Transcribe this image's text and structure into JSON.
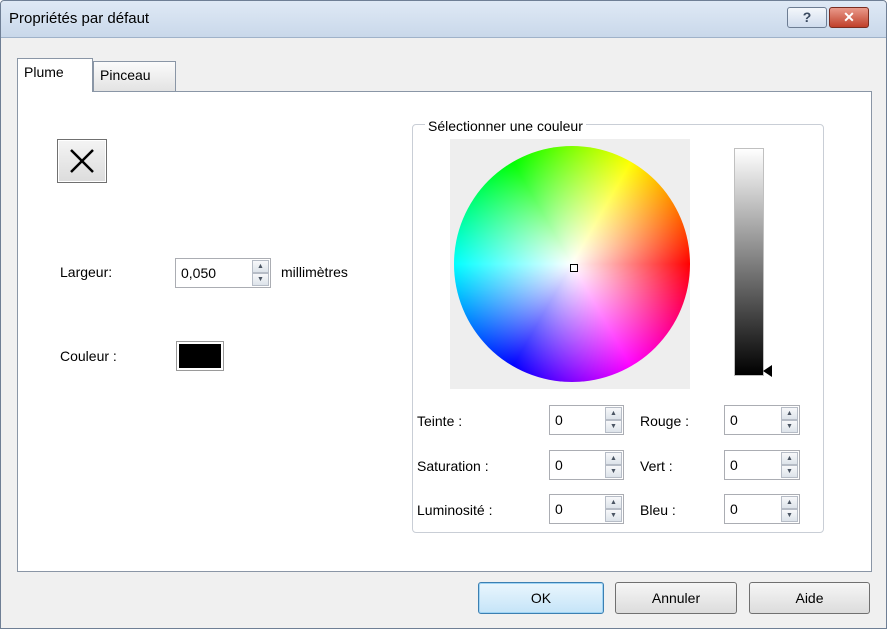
{
  "window": {
    "title": "Propriétés par défaut"
  },
  "titlebar": {
    "help_glyph": "?",
    "close_glyph": "✕"
  },
  "tabs": [
    {
      "label": "Plume",
      "active": true
    },
    {
      "label": "Pinceau",
      "active": false
    }
  ],
  "pen": {
    "style_glyph": "✕",
    "width_label": "Largeur:",
    "width_value": "0,050",
    "width_unit": "millimètres",
    "color_label": "Couleur :",
    "color_value": "#000000"
  },
  "color_picker": {
    "group_title": "Sélectionner une couleur",
    "luminance_bar": {
      "top_color": "#ffffff",
      "bottom_color": "#000000"
    },
    "fields": {
      "hue": {
        "label": "Teinte :",
        "value": "0"
      },
      "saturation": {
        "label": "Saturation :",
        "value": "0"
      },
      "luminosity": {
        "label": "Luminosité :",
        "value": "0"
      },
      "red": {
        "label": "Rouge :",
        "value": "0"
      },
      "green": {
        "label": "Vert :",
        "value": "0"
      },
      "blue": {
        "label": "Bleu :",
        "value": "0"
      }
    }
  },
  "footer": {
    "ok": "OK",
    "cancel": "Annuler",
    "help": "Aide"
  },
  "icons": {
    "spin_up": "▲",
    "spin_down": "▼"
  },
  "colors": {
    "accent_blue": "#3c7fb1",
    "close_red": "#c0402a",
    "selected_color": "#000000"
  }
}
